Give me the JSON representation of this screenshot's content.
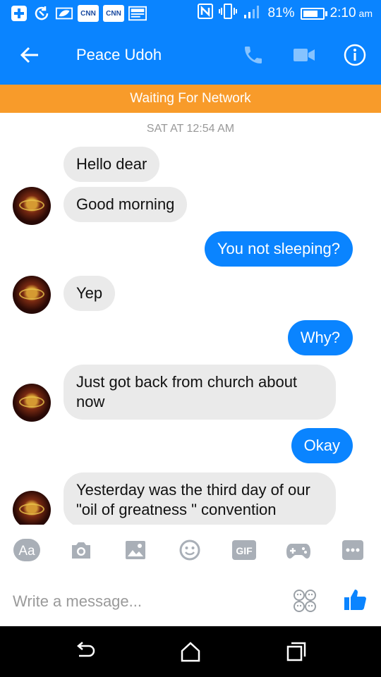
{
  "status_bar": {
    "notification_icons": [
      "plus-icon",
      "sync-icon",
      "leaf-mail-icon",
      "cnn-icon",
      "cnn-icon",
      "image-icon"
    ],
    "cnn_label_1": "CNN",
    "cnn_label_2": "CNN",
    "battery_percent": "81%",
    "battery_level": 0.81,
    "time": "2:10",
    "ampm": "am"
  },
  "header": {
    "title": "Peace Udoh",
    "icons": [
      "back-arrow-icon",
      "phone-icon",
      "video-camera-icon",
      "info-icon"
    ]
  },
  "banner": {
    "text": "Waiting For Network"
  },
  "conversation": {
    "timestamp": "SAT AT 12:54 AM",
    "messages": [
      {
        "from": "them",
        "text": "Hello dear"
      },
      {
        "from": "them",
        "text": "Good morning"
      },
      {
        "from": "me",
        "text": "You not sleeping?"
      },
      {
        "from": "them",
        "text": "Yep"
      },
      {
        "from": "me",
        "text": "Why?"
      },
      {
        "from": "them",
        "text": "Just got back from church about now"
      },
      {
        "from": "me",
        "text": "Okay"
      },
      {
        "from": "them",
        "text": "Yesterday was the third day of our \"oil of greatness \" convention"
      }
    ]
  },
  "toolbar": {
    "aa_label": "Aa",
    "gif_label": "GIF",
    "icons": [
      "text-format-icon",
      "camera-icon",
      "gallery-icon",
      "smiley-icon",
      "gif-icon",
      "gamepad-icon",
      "more-icon"
    ]
  },
  "composer": {
    "placeholder": "Write a message...",
    "icons": [
      "stickers-icon",
      "thumbs-up-icon"
    ]
  },
  "navbar": {
    "icons": [
      "nav-back-icon",
      "nav-home-icon",
      "nav-recents-icon"
    ]
  },
  "colors": {
    "brand_blue": "#0a84ff",
    "banner_orange": "#f89b2a",
    "bubble_gray": "#eaeaea"
  }
}
